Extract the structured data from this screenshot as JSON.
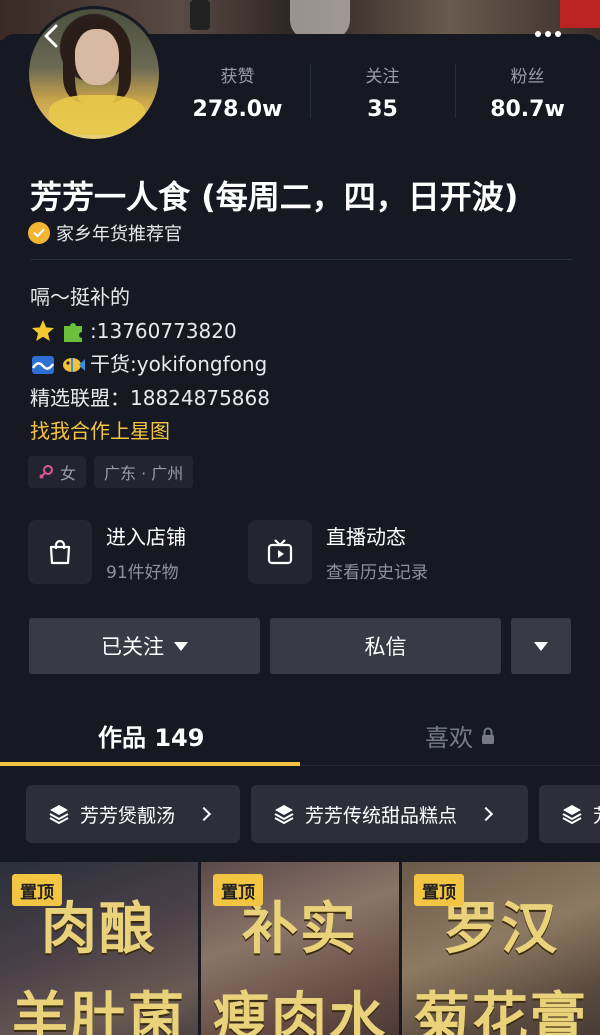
{
  "header": {
    "back_icon": "chevron-left-icon",
    "more_icon": "more-dots-icon"
  },
  "stats": [
    {
      "label": "获赞",
      "value": "278.0w"
    },
    {
      "label": "关注",
      "value": "35"
    },
    {
      "label": "粉丝",
      "value": "80.7w"
    }
  ],
  "profile": {
    "name": "芳芳一人食 (每周二，四，日开波)",
    "badge": "家乡年货推荐官",
    "bio": {
      "line1": "嗝～挺补的",
      "line2": ":13760773820",
      "line3": "干货:yokifongfong",
      "line4": "精选联盟：18824875868",
      "link": "找我合作上星图"
    },
    "tags": {
      "gender": "女",
      "location": "广东 · 广州"
    }
  },
  "services": {
    "shop": {
      "title": "进入店铺",
      "subtitle": "91件好物"
    },
    "live": {
      "title": "直播动态",
      "subtitle": "查看历史记录"
    }
  },
  "actions": {
    "followed": "已关注",
    "message": "私信"
  },
  "tabs": {
    "works": "作品 149",
    "likes": "喜欢"
  },
  "collections": [
    {
      "label": "芳芳煲靓汤"
    },
    {
      "label": "芳芳传统甜品糕点"
    },
    {
      "label": "芳"
    }
  ],
  "videos": [
    {
      "pin": "置顶",
      "line1": "肉酿",
      "line2": "羊肚菌"
    },
    {
      "pin": "置顶",
      "line1": "补实",
      "line2": "瘦肉水"
    },
    {
      "pin": "置顶",
      "line1": "罗汉",
      "line2": "菊花膏"
    }
  ],
  "colors": {
    "accent": "#f4c443",
    "background": "#161922",
    "button": "#383b46"
  }
}
